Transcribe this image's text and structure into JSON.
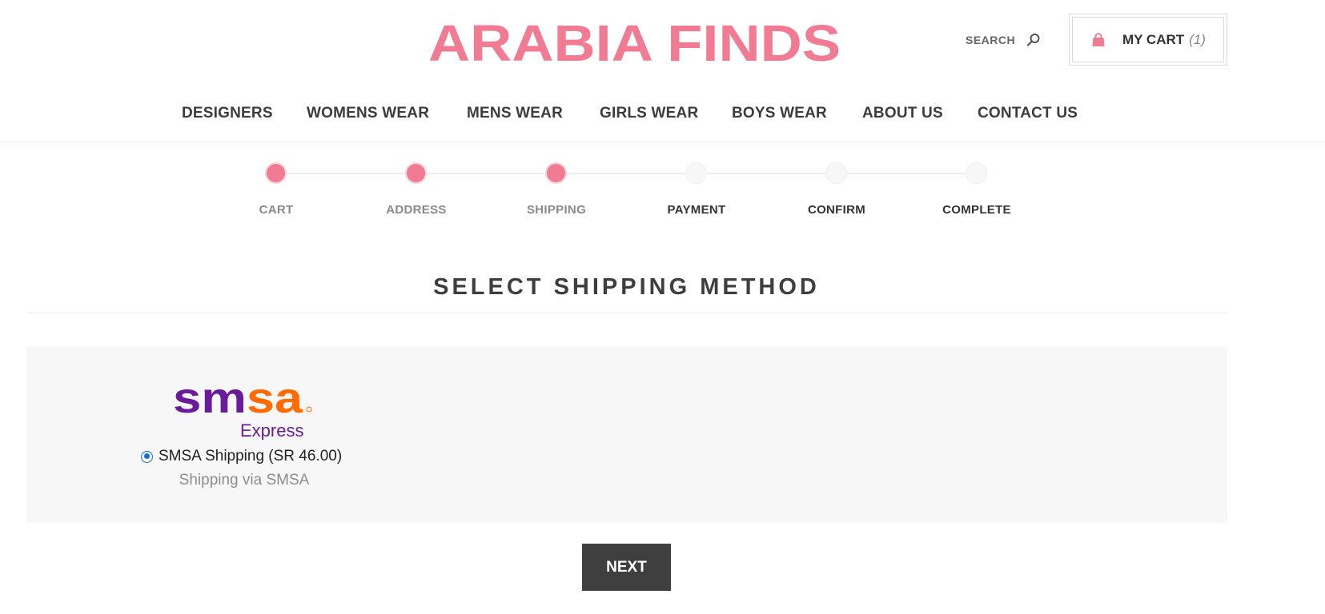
{
  "brand": {
    "name": "ARABIA FINDS",
    "color": "#f07b93"
  },
  "header": {
    "search_label": "SEARCH",
    "search_icon": "search-icon",
    "cart_icon": "shopping-bag-icon",
    "cart_label": "MY CART",
    "cart_count": "(1)"
  },
  "nav": {
    "items": [
      {
        "label": "DESIGNERS"
      },
      {
        "label": "WOMENS WEAR"
      },
      {
        "label": "MENS WEAR"
      },
      {
        "label": "GIRLS WEAR"
      },
      {
        "label": "BOYS WEAR"
      },
      {
        "label": "ABOUT US"
      },
      {
        "label": "CONTACT US"
      }
    ]
  },
  "checkout_steps": [
    {
      "label": "CART",
      "done": true
    },
    {
      "label": "ADDRESS",
      "done": true
    },
    {
      "label": "SHIPPING",
      "done": true
    },
    {
      "label": "PAYMENT",
      "done": false
    },
    {
      "label": "CONFIRM",
      "done": false
    },
    {
      "label": "COMPLETE",
      "done": false
    }
  ],
  "page": {
    "title": "SELECT SHIPPING METHOD"
  },
  "shipping": {
    "logo_text": "smsa",
    "logo_subtext": "Express",
    "logo_purple": "#6a1b9a",
    "logo_orange": "#ff6b00",
    "option_label": "SMSA Shipping (SR 46.00)",
    "option_selected": true,
    "description": "Shipping via SMSA"
  },
  "actions": {
    "next_label": "NEXT",
    "button_color": "#3f3f3f"
  }
}
